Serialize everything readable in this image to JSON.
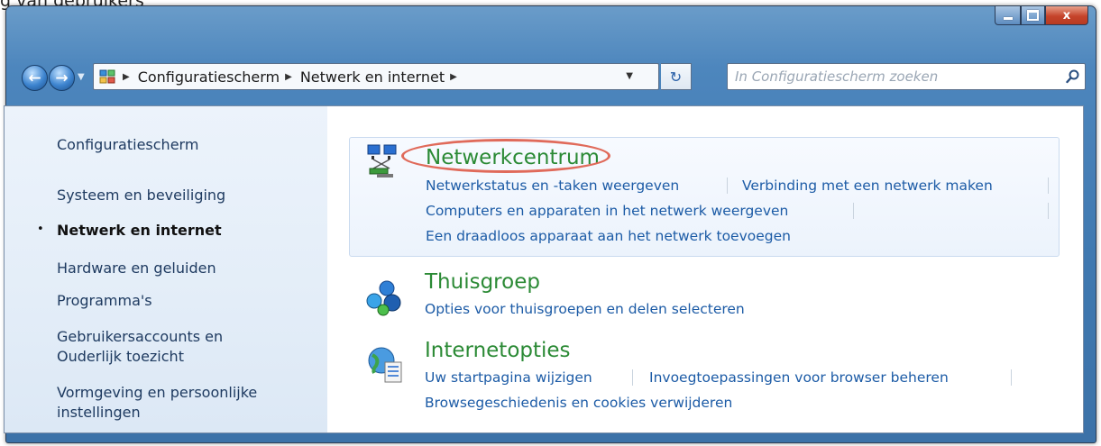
{
  "top_caption": "g van gebruikers",
  "window": {
    "controls": {
      "minimize_icon": "minimize-icon",
      "maximize_icon": "maximize-icon",
      "close_icon": "close-icon",
      "close_glyph": "x"
    }
  },
  "nav": {
    "back_glyph": "←",
    "forward_glyph": "→",
    "recent_glyph": "▼"
  },
  "address": {
    "crumbs": [
      "Configuratiescherm",
      "Netwerk en internet"
    ],
    "separator": "▶",
    "dropdown_glyph": "▼",
    "refresh_glyph": "↻"
  },
  "search": {
    "placeholder": "In Configuratiescherm zoeken"
  },
  "sidebar": {
    "items": [
      {
        "label": "Configuratiescherm"
      },
      {
        "label": "Systeem en beveiliging"
      },
      {
        "label": "Netwerk en internet"
      },
      {
        "label": "Hardware en geluiden"
      },
      {
        "label": "Programma's"
      },
      {
        "label": "Gebruikersaccounts en"
      },
      {
        "label": "Ouderlijk toezicht"
      },
      {
        "label": "Vormgeving en persoonlijke"
      },
      {
        "label": "instellingen"
      }
    ],
    "bullet": "•"
  },
  "categories": [
    {
      "title": "Netwerkcentrum",
      "links": [
        "Netwerkstatus en -taken weergeven",
        "Verbinding met een netwerk maken",
        "Computers en apparaten in het netwerk weergeven",
        "Een draadloos apparaat aan het netwerk toevoegen"
      ]
    },
    {
      "title": "Thuisgroep",
      "links": [
        "Opties voor thuisgroepen en delen selecteren"
      ]
    },
    {
      "title": "Internetopties",
      "links": [
        "Uw startpagina wijzigen",
        "Invoegtoepassingen voor browser beheren",
        "Browsegeschiedenis en cookies verwijderen"
      ]
    }
  ],
  "colors": {
    "title_green": "#2b8a35",
    "link_blue": "#1c5ba6",
    "highlight_ellipse": "#e06a5a"
  }
}
